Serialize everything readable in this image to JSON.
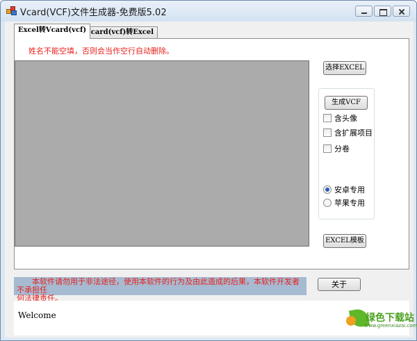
{
  "window": {
    "title": "Vcard(VCF)文件生成器-免费版5.02"
  },
  "tabs": [
    {
      "label": "Excel转Vcard(vcf)",
      "active": true
    },
    {
      "label": "Vcard(vcf)转Excel",
      "active": false
    }
  ],
  "panel": {
    "warning": "姓名不能空填，否则会当作空行自动删除。",
    "select_excel_button": "选择EXCEL",
    "generate_vcf_button": "生成VCF",
    "checkboxes": [
      {
        "label": "含头像",
        "checked": false
      },
      {
        "label": "含扩展项目",
        "checked": false
      },
      {
        "label": "分卷",
        "checked": false
      }
    ],
    "radios": [
      {
        "label": "安卓专用",
        "selected": true
      },
      {
        "label": "苹果专用",
        "selected": false
      }
    ],
    "excel_template_button": "EXCEL模板"
  },
  "disclaimer": {
    "line1": "　　本软件请勿用于非法途径，使用本软件的行为及由此造成的后果，本软件开发者不承担任",
    "line2": "何法律责任。"
  },
  "about_button": "关于",
  "log": {
    "text": "Welcome"
  },
  "watermark": {
    "title": "绿色下载站",
    "url": "www.greenxiazai.com"
  },
  "colors": {
    "warning_red": "#e8221c",
    "disclaimer_bg": "#a6bad2",
    "preview_gray": "#ababab",
    "radio_accent": "#2a5fb0"
  }
}
